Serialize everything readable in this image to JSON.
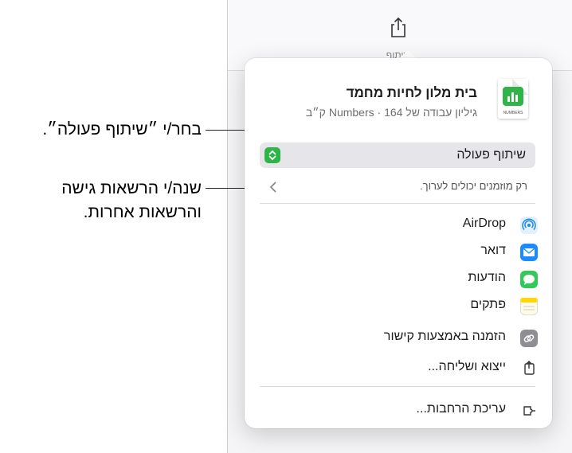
{
  "callouts": {
    "choose_collaborate": "בחר/י ״שיתוף פעולה״.",
    "change_permissions_line1": "שנה/י הרשאות גישה",
    "change_permissions_line2": "והרשאות אחרות."
  },
  "toolbar": {
    "share_icon": "share-icon",
    "share_label": "שיתוף"
  },
  "popover": {
    "document_title": "בית מלון לחיות מחמד",
    "document_subtitle": "גיליון עבודה של Numbers · 164 ק״ב",
    "thumbnail_caption": "NUMBERS",
    "collaboration_mode": "שיתוף פעולה",
    "access_summary": "רק מוזמנים יכולים לערוך.",
    "share_items": [
      {
        "label": "AirDrop",
        "icon": "airdrop-icon"
      },
      {
        "label": "דואר",
        "icon": "mail-icon"
      },
      {
        "label": "הודעות",
        "icon": "messages-icon"
      },
      {
        "label": "פתקים",
        "icon": "notes-icon"
      },
      {
        "label": "הזמנה באמצעות קישור",
        "icon": "link-icon"
      },
      {
        "label": "ייצוא ושליחה...",
        "icon": "export-icon"
      }
    ],
    "edit_extensions": {
      "label": "עריכת הרחבות...",
      "icon": "extensions-icon"
    }
  },
  "colors": {
    "numbers_green": "#2fb447",
    "airdrop_blue": "#1e88e5",
    "mail_blue": "#1a8cff",
    "messages_green": "#34c759",
    "notes_yellow": "#ffd60a",
    "link_gray": "#8e8e93"
  }
}
